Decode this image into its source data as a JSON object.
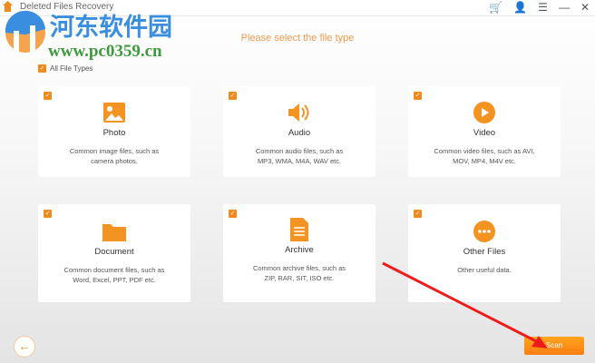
{
  "app": {
    "title": "Deleted Files Recovery",
    "icons": [
      "cart-icon",
      "user-icon",
      "menu-icon",
      "minimize-icon",
      "close-icon"
    ]
  },
  "watermark": {
    "name": "河东软件园",
    "url": "www.pc0359.cn"
  },
  "heading": "Please select the file type",
  "all_types": {
    "label": "All File Types",
    "checked": true
  },
  "cards": [
    {
      "name": "Photo",
      "desc": "Common image files, such as camera photos.",
      "checked": true,
      "icon": "photo-icon"
    },
    {
      "name": "Audio",
      "desc": "Common audio files, such as MP3, WMA, M4A, WAV etc.",
      "checked": true,
      "icon": "audio-icon"
    },
    {
      "name": "Video",
      "desc": "Common video files, such as AVI, MOV, MP4, M4V etc.",
      "checked": true,
      "icon": "video-icon"
    },
    {
      "name": "Document",
      "desc": "Common document files, such as Word, Excel, PPT, PDF etc.",
      "checked": true,
      "icon": "folder-icon"
    },
    {
      "name": "Archive",
      "desc": "Common archive files, such as ZIP, RAR, SIT, ISO etc.",
      "checked": true,
      "icon": "archive-icon"
    },
    {
      "name": "Other Files",
      "desc": "Other useful data.",
      "checked": true,
      "icon": "more-icon"
    }
  ],
  "scan_label": "Scan",
  "accent": "#f08a1c"
}
